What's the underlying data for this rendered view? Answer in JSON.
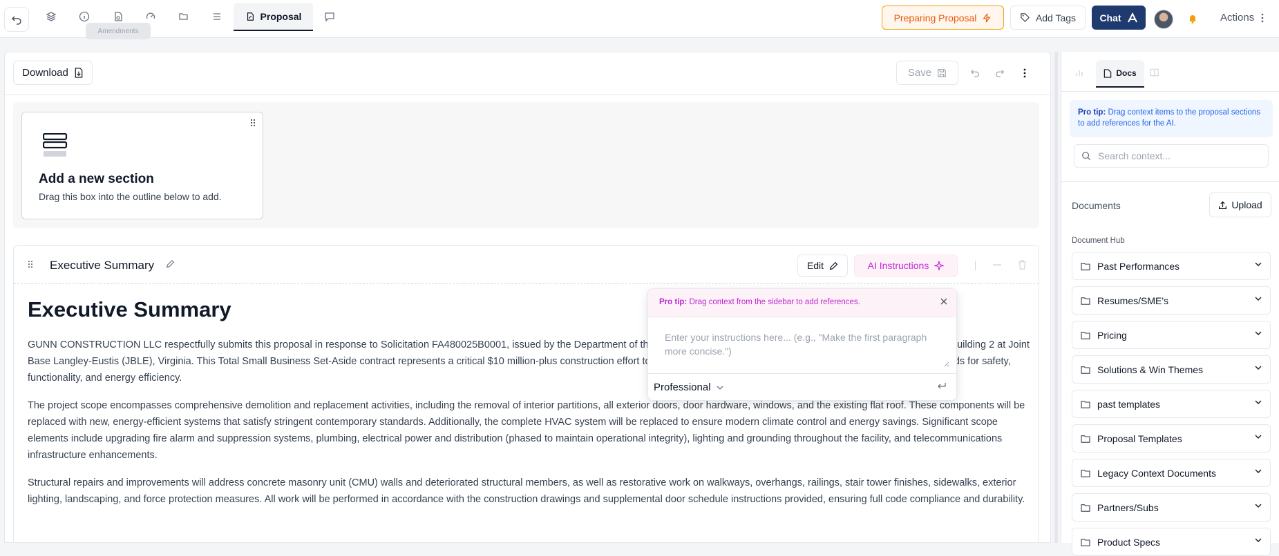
{
  "topbar": {
    "tooltip": "Amendments",
    "active_tab": "Proposal",
    "preparing_label": "Preparing Proposal",
    "add_tags_label": "Add Tags",
    "chat_label": "Chat",
    "actions_label": "Actions"
  },
  "toolbar": {
    "download_label": "Download",
    "save_label": "Save"
  },
  "new_section": {
    "title": "Add a new section",
    "subtitle": "Drag this box into the outline below to add."
  },
  "section": {
    "title": "Executive Summary",
    "edit_label": "Edit",
    "ai_label": "AI Instructions"
  },
  "document": {
    "heading": "Executive Summary",
    "paragraphs": [
      "GUNN CONSTRUCTION LLC respectfully submits this proposal in response to Solicitation FA480025B0001, issued by the Department of the Air Force, for the comprehensive renovation and modernization of Building 2 at Joint Base Langley-Eustis (JBLE), Virginia. This Total Small Business Set-Aside contract represents a critical $10 million-plus construction effort to bring the facility into full compliance with current operational standards for safety, functionality, and energy efficiency.",
      "The project scope encompasses comprehensive demolition and replacement activities, including the removal of interior partitions, all exterior doors, door hardware, windows, and the existing flat roof. These components will be replaced with new, energy-efficient systems that satisfy stringent contemporary standards. Additionally, the complete HVAC system will be replaced to ensure modern climate control and energy savings. Significant scope elements include upgrading fire alarm and suppression systems, plumbing, electrical power and distribution (phased to maintain operational integrity), lighting and grounding throughout the facility, and telecommunications infrastructure enhancements.",
      "Structural repairs and improvements will address concrete masonry unit (CMU) walls and deteriorated structural members, as well as restorative work on walkways, overhangs, railings, stair tower finishes, sidewalks, exterior lighting, landscaping, and force protection measures. All work will be performed in accordance with the construction drawings and supplemental door schedule instructions provided, ensuring full code compliance and durability."
    ]
  },
  "ai_popover": {
    "tip_bold": "Pro tip:",
    "tip_text": "Drag context from the sidebar to add references.",
    "placeholder": "Enter your instructions here... (e.g., \"Make the first paragraph more concise.\")",
    "style": "Professional"
  },
  "sidebar": {
    "docs_tab": "Docs",
    "tip_bold": "Pro tip:",
    "tip_text": "Drag context items to the proposal sections to add references for the AI.",
    "search_placeholder": "Search context...",
    "documents_label": "Documents",
    "upload_label": "Upload",
    "hub_label": "Document Hub",
    "folders": [
      "Past Performances",
      "Resumes/SME's",
      "Pricing",
      "Solutions & Win Themes",
      "past templates",
      "Proposal Templates",
      "Legacy Context Documents",
      "Partners/Subs",
      "Product Specs"
    ]
  },
  "colors": {
    "chat_bg": "#1e3a6e",
    "accent_orange": "#ea580c",
    "ai_pink": "#c026d3",
    "tip_blue": "#2563eb"
  }
}
